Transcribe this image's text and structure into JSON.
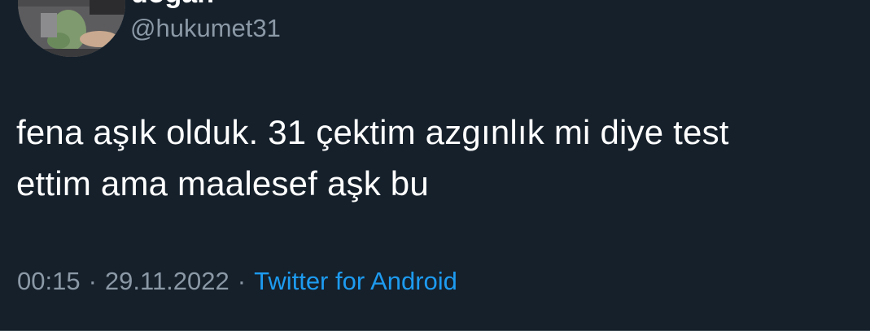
{
  "user": {
    "display_name": "doğan",
    "handle": "@hukumet31"
  },
  "tweet": {
    "text": "fena aşık olduk. 31 çektim azgınlık mi diye test\nettim ama maalesef aşk bu",
    "time": "00:15",
    "separator": "·",
    "date": "29.11.2022",
    "source": "Twitter for Android"
  },
  "colors": {
    "background": "#15202b",
    "text": "#ffffff",
    "secondary": "#8b98a5",
    "link": "#1d9bf0"
  },
  "icons": {
    "avatar": "avatar-image",
    "more": "more-options-icon"
  }
}
